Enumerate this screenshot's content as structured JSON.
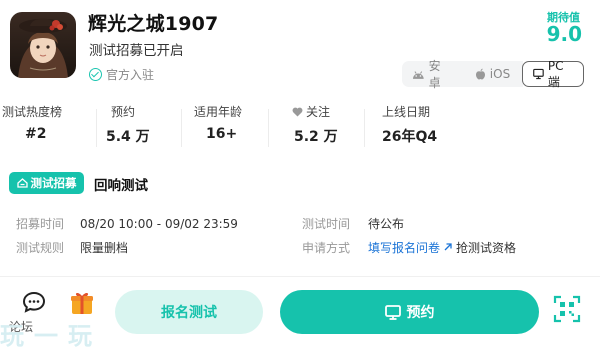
{
  "header": {
    "title": "辉光之城1907",
    "subtitle": "测试招募已开启",
    "official": "官方入驻",
    "rating_label": "期待值",
    "rating_value": "9.0",
    "platforms": [
      "安卓",
      "iOS",
      "PC端"
    ]
  },
  "stats": [
    {
      "label": "测试热度榜",
      "value": "#2"
    },
    {
      "label": "预约",
      "value": "5.4 万"
    },
    {
      "label": "适用年龄",
      "value": "16+"
    },
    {
      "label": "关注",
      "value": "5.2 万"
    },
    {
      "label": "上线日期",
      "value": "26年Q4"
    }
  ],
  "recruit": {
    "tag": "测试招募",
    "title": "回响测试",
    "time_label": "招募时间",
    "time_value": "08/20 10:00 - 09/02 23:59",
    "test_time_label": "测试时间",
    "test_time_value": "待公布",
    "rule_label": "测试规则",
    "rule_value": "限量删档",
    "apply_label": "申请方式",
    "apply_link": "填写报名问卷",
    "apply_suffix": "抢测试资格"
  },
  "actions": {
    "forum_label": "论坛",
    "signup": "报名测试",
    "reserve": "预约"
  },
  "watermark": "玩一玩",
  "colors": {
    "accent": "#16c2ac",
    "accent_light": "#d9f5f0",
    "link": "#1a73d6"
  }
}
